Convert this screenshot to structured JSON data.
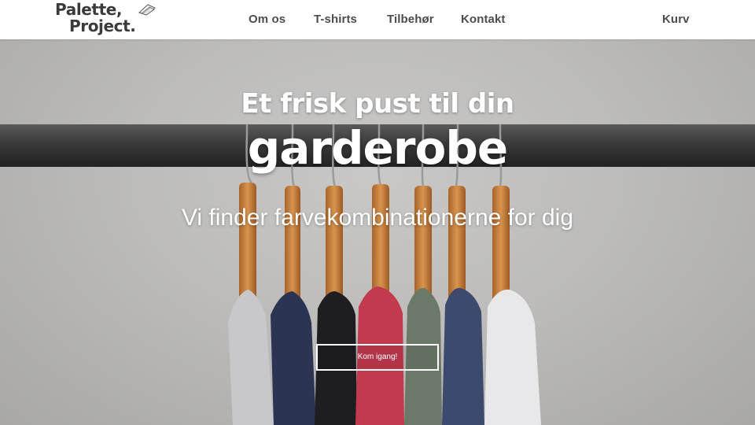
{
  "brand": {
    "logo_line1": "Palette,",
    "logo_line2": "Project."
  },
  "nav": {
    "items": [
      {
        "label": "Om os"
      },
      {
        "label": "T-shirts"
      },
      {
        "label": "Tilbehør"
      },
      {
        "label": "Kontakt"
      }
    ],
    "cart_label": "Kurv"
  },
  "hero": {
    "title_line1": "Et frisk pust til din",
    "title_line2": "garderobe",
    "subtitle": "Vi finder farvekombinationerne for dig",
    "cta_label": "Kom igang!"
  },
  "colors": {
    "header_bg": "#ffffff",
    "nav_text": "#4d4d4d",
    "hero_text": "#ffffff",
    "rail": "#3d3d3d",
    "hanger_wood": "#c7803e",
    "shirts": [
      "#c8c8cc",
      "#2b3452",
      "#1e1e22",
      "#c23a4e",
      "#6b7a68",
      "#3c4a6e",
      "#e8e8ea"
    ]
  }
}
